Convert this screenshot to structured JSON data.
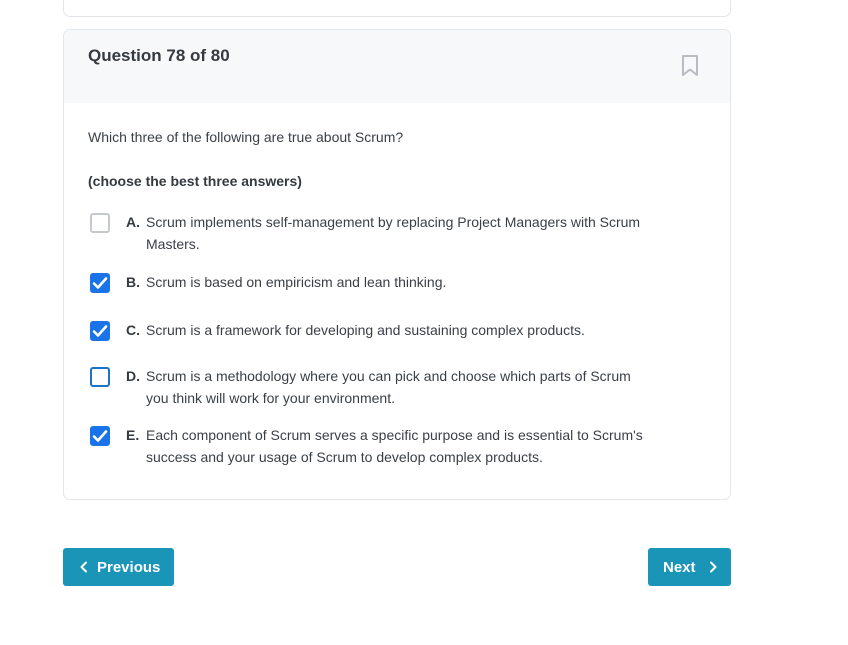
{
  "question": {
    "header": "Question 78 of 80",
    "text": "Which three of the following are true about Scrum?",
    "instruction": "(choose the best three answers)",
    "options": [
      {
        "letter": "A.",
        "text": "Scrum implements self-management by replacing Project Managers with Scrum Masters.",
        "checked": false
      },
      {
        "letter": "B.",
        "text": "Scrum is based on empiricism and lean thinking.",
        "checked": true
      },
      {
        "letter": "C.",
        "text": "Scrum is a framework for developing and sustaining complex products.",
        "checked": true
      },
      {
        "letter": "D.",
        "text": "Scrum is a methodology where you can pick and choose which parts of Scrum you think will work for your environment.",
        "checked": false
      },
      {
        "letter": "E.",
        "text": "Each component of Scrum serves a specific purpose and is essential to Scrum's success and your usage of Scrum to develop complex products.",
        "checked": true
      }
    ]
  },
  "icons": {
    "bookmark": "bookmark-icon",
    "checkmark": "checkmark-icon",
    "prev": "chevron-left-icon",
    "next": "chevron-right-icon"
  },
  "nav": {
    "previous_label": "Previous",
    "next_label": "Next"
  },
  "colors": {
    "accent_button": "#1a95b8",
    "checkbox_checked": "#1a73e8",
    "header_bg": "#f7f8fa"
  }
}
